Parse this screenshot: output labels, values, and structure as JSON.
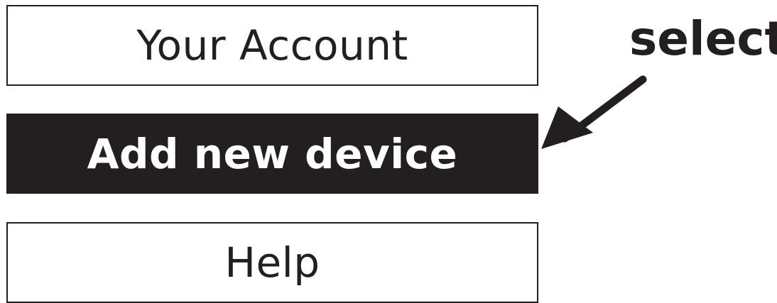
{
  "menu": {
    "items": [
      {
        "label": "Your Account",
        "selected": false
      },
      {
        "label": "Add new device",
        "selected": true
      },
      {
        "label": "Help",
        "selected": false
      }
    ]
  },
  "callout": {
    "label": "select",
    "icon": "arrow-icon"
  },
  "colors": {
    "ink": "#231f20",
    "background": "#ffffff"
  }
}
